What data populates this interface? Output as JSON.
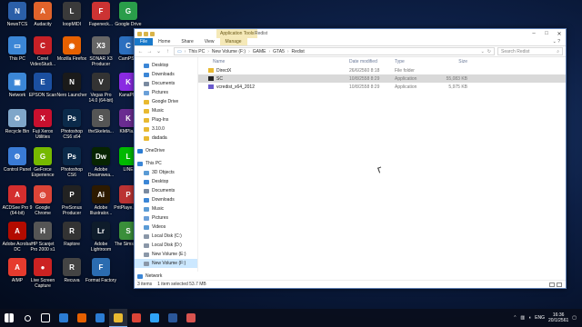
{
  "desktop_icons": [
    {
      "label": "NewsTCS",
      "icon": "app-icon",
      "color": "#2b5fa8",
      "glyph": "N"
    },
    {
      "label": "Audacity",
      "icon": "audacity-icon",
      "color": "#e0632b",
      "glyph": "A"
    },
    {
      "label": "loopMIDI",
      "icon": "midi-icon",
      "color": "#3a3a3a",
      "glyph": "L"
    },
    {
      "label": "Fapeneck...",
      "icon": "app-icon",
      "color": "#c33",
      "glyph": "F"
    },
    {
      "label": "Google Drive",
      "icon": "google-drive-icon",
      "color": "#2a9d4a",
      "glyph": "G"
    },
    {
      "label": "This PC",
      "icon": "this-pc-icon",
      "color": "#3b86d6",
      "glyph": "▭"
    },
    {
      "label": "Corel VideoStudi...",
      "icon": "corel-icon",
      "color": "#c72026",
      "glyph": "C"
    },
    {
      "label": "Mozilla Firefox",
      "icon": "firefox-icon",
      "color": "#e66000",
      "glyph": "◉"
    },
    {
      "label": "SONAR X3 Producer",
      "icon": "sonar-icon",
      "color": "#666",
      "glyph": "X3"
    },
    {
      "label": "CamPS...",
      "icon": "app-icon",
      "color": "#2c6fbf",
      "glyph": "C"
    },
    {
      "label": "Network",
      "icon": "network-icon",
      "color": "#3b86d6",
      "glyph": "▣"
    },
    {
      "label": "EPSON Scan",
      "icon": "epson-icon",
      "color": "#1b4fa0",
      "glyph": "E"
    },
    {
      "label": "Nero Launcher",
      "icon": "nero-icon",
      "color": "#1a1a1a",
      "glyph": "N"
    },
    {
      "label": "Vegas Pro 14.0 (64-bit)",
      "icon": "vegas-icon",
      "color": "#333",
      "glyph": "V"
    },
    {
      "label": "KanaPl...",
      "icon": "app-icon",
      "color": "#8a2be2",
      "glyph": "K"
    },
    {
      "label": "Recycle Bin",
      "icon": "recycle-bin-icon",
      "color": "#7fa6c9",
      "glyph": "♻"
    },
    {
      "label": "Fuji Xerox Utilities",
      "icon": "xerox-icon",
      "color": "#c8102e",
      "glyph": "X"
    },
    {
      "label": "Photoshop CS6 x64",
      "icon": "photoshop-icon",
      "color": "#0b2a4a",
      "glyph": "Ps"
    },
    {
      "label": "theSkeleta...",
      "icon": "app-icon",
      "color": "#555",
      "glyph": "S"
    },
    {
      "label": "KMPla...",
      "icon": "kmplayer-icon",
      "color": "#6a2c91",
      "glyph": "K"
    },
    {
      "label": "Control Panel",
      "icon": "control-panel-icon",
      "color": "#3a7bd5",
      "glyph": "⚙"
    },
    {
      "label": "GeForce Experience",
      "icon": "geforce-icon",
      "color": "#76b900",
      "glyph": "G"
    },
    {
      "label": "Photoshop CS6",
      "icon": "photoshop-icon",
      "color": "#0b2a4a",
      "glyph": "Ps"
    },
    {
      "label": "Adobe Dreamwea...",
      "icon": "dreamweaver-icon",
      "color": "#072401",
      "glyph": "Dw"
    },
    {
      "label": "LINE",
      "icon": "line-icon",
      "color": "#00b900",
      "glyph": "L"
    },
    {
      "label": "ACDSee Pro 9 (64-bit)",
      "icon": "acdsee-icon",
      "color": "#d42e2e",
      "glyph": "A"
    },
    {
      "label": "Google Chrome",
      "icon": "chrome-icon",
      "color": "#db4437",
      "glyph": "◎"
    },
    {
      "label": "PreSonus Producer",
      "icon": "presonus-icon",
      "color": "#222",
      "glyph": "P"
    },
    {
      "label": "Adobe Illustrator...",
      "icon": "illustrator-icon",
      "color": "#2d1a00",
      "glyph": "Ai"
    },
    {
      "label": "PritPlaye... Bit",
      "icon": "app-icon",
      "color": "#b33",
      "glyph": "P"
    },
    {
      "label": "Adobe Acrobat DC",
      "icon": "acrobat-icon",
      "color": "#b30b00",
      "glyph": "A"
    },
    {
      "label": "HP Scanjet Pro 2000 s1",
      "icon": "hp-scanner-icon",
      "color": "#555",
      "glyph": "H"
    },
    {
      "label": "Raptore",
      "icon": "app-icon",
      "color": "#333",
      "glyph": "R"
    },
    {
      "label": "Adobe Lightroom",
      "icon": "lightroom-icon",
      "color": "#0e1c2b",
      "glyph": "Lr"
    },
    {
      "label": "The Sims x64",
      "icon": "sims-icon",
      "color": "#3a8f3a",
      "glyph": "S"
    },
    {
      "label": "AIMP",
      "icon": "aimp-icon",
      "color": "#e63b2e",
      "glyph": "A"
    },
    {
      "label": "Live Screen Capture",
      "icon": "screen-capture-icon",
      "color": "#c22",
      "glyph": "●"
    },
    {
      "label": "Recuva",
      "icon": "recuva-icon",
      "color": "#444",
      "glyph": "R"
    },
    {
      "label": "Format Factory",
      "icon": "format-factory-icon",
      "color": "#2b6cb0",
      "glyph": "F"
    }
  ],
  "window": {
    "context_tab_title": "Application Tools",
    "title": "Redist",
    "ribbon_tabs": [
      "File",
      "Home",
      "Share",
      "View",
      "Manage"
    ],
    "breadcrumb": [
      "This PC",
      "New Volume (F:)",
      "GAME",
      "GTA5",
      "Redist"
    ],
    "search_placeholder": "Search Redist",
    "columns": {
      "name": "Name",
      "date": "Date modified",
      "type": "Type",
      "size": "Size"
    },
    "files": [
      {
        "name": "DirectX",
        "date": "26/6/2560 8:18",
        "type": "File folder",
        "size": "",
        "icon": "folder-icon",
        "selected": false
      },
      {
        "name": "SC",
        "date": "10/8/2558 8:29",
        "type": "Application",
        "size": "55,083 KB",
        "icon": "application-icon",
        "selected": true
      },
      {
        "name": "vcredist_x64_2012",
        "date": "10/8/2558 8:29",
        "type": "Application",
        "size": "5,975 KB",
        "icon": "installer-icon",
        "selected": false
      }
    ],
    "nav_items": [
      {
        "label": "Desktop",
        "icon": "desktop-icon",
        "color": "#3b86d6",
        "level": 2
      },
      {
        "label": "Downloads",
        "icon": "downloads-icon",
        "color": "#3b86d6",
        "level": 2
      },
      {
        "label": "Documents",
        "icon": "documents-icon",
        "color": "#7a8aa0",
        "level": 2
      },
      {
        "label": "Pictures",
        "icon": "pictures-icon",
        "color": "#6a9fd8",
        "level": 2
      },
      {
        "label": "Google Drive",
        "icon": "google-drive-icon",
        "color": "#e8b931",
        "level": 2
      },
      {
        "label": "Music",
        "icon": "music-icon",
        "color": "#e8b931",
        "level": 2
      },
      {
        "label": "Plug-Ins",
        "icon": "folder-icon",
        "color": "#e8b931",
        "level": 2
      },
      {
        "label": "3.10.0",
        "icon": "folder-icon",
        "color": "#e8b931",
        "level": 2
      },
      {
        "label": "dadada",
        "icon": "folder-icon",
        "color": "#e8b931",
        "level": 2
      },
      {
        "label": "",
        "icon": "",
        "color": "",
        "level": 0
      },
      {
        "label": "OneDrive",
        "icon": "onedrive-icon",
        "color": "#2b7cd3",
        "level": 1
      },
      {
        "label": "",
        "icon": "",
        "color": "",
        "level": 0
      },
      {
        "label": "This PC",
        "icon": "this-pc-icon",
        "color": "#3b86d6",
        "level": 1
      },
      {
        "label": "3D Objects",
        "icon": "3d-objects-icon",
        "color": "#5a9bd5",
        "level": 2
      },
      {
        "label": "Desktop",
        "icon": "desktop-icon",
        "color": "#3b86d6",
        "level": 2
      },
      {
        "label": "Documents",
        "icon": "documents-icon",
        "color": "#7a8aa0",
        "level": 2
      },
      {
        "label": "Downloads",
        "icon": "downloads-icon",
        "color": "#3b86d6",
        "level": 2
      },
      {
        "label": "Music",
        "icon": "music-icon",
        "color": "#5a9bd5",
        "level": 2
      },
      {
        "label": "Pictures",
        "icon": "pictures-icon",
        "color": "#6a9fd8",
        "level": 2
      },
      {
        "label": "Videos",
        "icon": "videos-icon",
        "color": "#5a9bd5",
        "level": 2
      },
      {
        "label": "Local Disk (C:)",
        "icon": "drive-icon",
        "color": "#8a97a8",
        "level": 2
      },
      {
        "label": "Local Disk (D:)",
        "icon": "drive-icon",
        "color": "#8a97a8",
        "level": 2
      },
      {
        "label": "New Volume (E:)",
        "icon": "drive-icon",
        "color": "#8a97a8",
        "level": 2
      },
      {
        "label": "New Volume (F:)",
        "icon": "drive-icon",
        "color": "#8a97a8",
        "level": 2,
        "selected": true
      },
      {
        "label": "",
        "icon": "",
        "color": "",
        "level": 0
      },
      {
        "label": "Network",
        "icon": "network-icon",
        "color": "#3b86d6",
        "level": 1
      }
    ],
    "status": {
      "items": "3 items",
      "selected": "1 item selected  53.7 MB"
    }
  },
  "taskbar": {
    "apps": [
      {
        "icon": "start-icon",
        "color": "#ffffff",
        "active": false
      },
      {
        "icon": "search-icon",
        "color": "#ffffff",
        "active": false
      },
      {
        "icon": "task-view-icon",
        "color": "#ffffff",
        "active": false
      },
      {
        "icon": "edge-icon",
        "color": "#2b7cd3",
        "active": false
      },
      {
        "icon": "firefox-icon",
        "color": "#e66000",
        "active": false
      },
      {
        "icon": "store-icon",
        "color": "#2b7cd3",
        "active": false
      },
      {
        "icon": "file-explorer-icon",
        "color": "#e8b931",
        "active": true
      },
      {
        "icon": "chrome-icon",
        "color": "#db4437",
        "active": false
      },
      {
        "icon": "photoshop-icon",
        "color": "#2fa3f7",
        "active": false
      },
      {
        "icon": "word-icon",
        "color": "#2b579a",
        "active": false
      },
      {
        "icon": "media-icon",
        "color": "#d9534f",
        "active": false
      }
    ],
    "lang": "ENG",
    "time": "16:36",
    "date": "20/1/2561"
  }
}
